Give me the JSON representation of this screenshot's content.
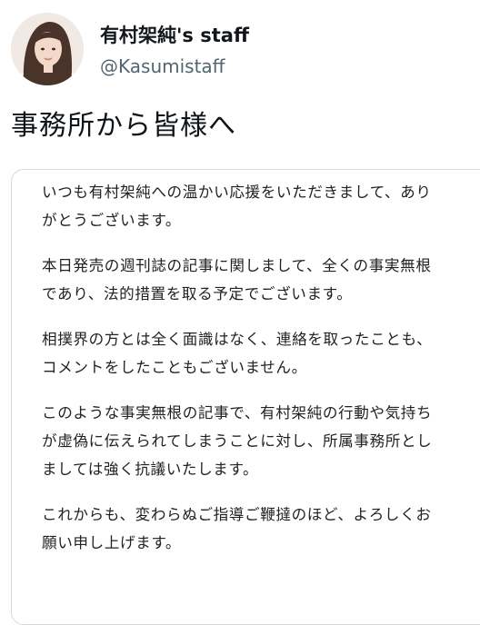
{
  "profile": {
    "display_name": "有村架純's staff",
    "handle": "@Kasumistaff",
    "avatar_icon": "profile-photo"
  },
  "tweet": {
    "text": "事務所から皆様へ"
  },
  "notice": {
    "paragraphs": [
      [
        "いつも有村架純への温かい応援をいただきまして、あり",
        "がとうございます。"
      ],
      [
        "本日発売の週刊誌の記事に関しまして、全くの事実無根",
        "であり、法的措置を取る予定でございます。"
      ],
      [
        "相撲界の方とは全く面識はなく、連絡を取ったことも、",
        "コメントをしたこともございません。"
      ],
      [
        "このような事実無根の記事で、有村架純の行動や気持ち",
        "が虚偽に伝えられてしまうことに対し、所属事務所とし",
        "ましては強く抗議いたします。"
      ],
      [
        "これからも、変わらぬご指導ご鞭撻のほど、よろしくお",
        "願い申し上げます。"
      ]
    ]
  }
}
